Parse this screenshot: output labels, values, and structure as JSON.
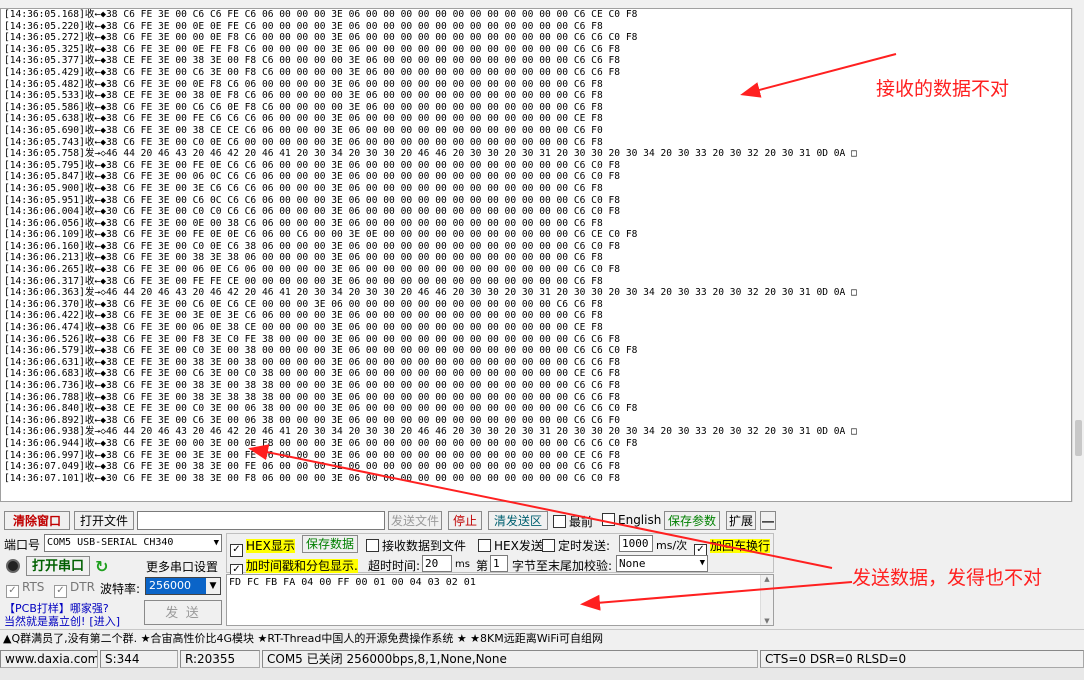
{
  "log": {
    "lines": [
      "[14:36:05.168]收←◆38 C6 FE 3E 00 C6 C6 FE C6 06 00 00 00 3E 06 00 00 00 00 00 00 00 00 00 00 00 00 C6 CE C0 F8",
      "[14:36:05.220]收←◆38 C6 FE 3E 00 0E 0E FE C6 00 00 00 00 3E 06 00 00 00 00 00 00 00 00 00 00 00 00 C6 F8",
      "[14:36:05.272]收←◆38 C6 FE 3E 00 00 0E F8 C6 00 00 00 00 3E 06 00 00 00 00 00 00 00 00 00 00 00 00 C6 C6 C0 F8",
      "[14:36:05.325]收←◆38 C6 FE 3E 00 0E FE F8 C6 00 00 00 00 3E 06 00 00 00 00 00 00 00 00 00 00 00 00 C6 C6 F8",
      "[14:36:05.377]收←◆38 CE FE 3E 00 38 3E 00 F8 C6 00 00 00 00 3E 06 00 00 00 00 00 00 00 00 00 00 00 C6 C6 F8",
      "[14:36:05.429]收←◆38 C6 FE 3E 00 C6 3E 00 F8 C6 00 00 00 00 3E 06 00 00 00 00 00 00 00 00 00 00 00 C6 C6 F8",
      "[14:36:05.482]收←◆38 C6 FE 3E 00 0E F8 C6 06 00 00 00 00 3E 06 00 00 00 00 00 00 00 00 00 00 00 00 C6 F8",
      "[14:36:05.533]收←◆38 CE FE 3E 00 38 0E F8 C6 06 00 00 00 00 3E 06 00 00 00 00 00 00 00 00 00 00 00 C6 F8",
      "[14:36:05.586]收←◆38 C6 FE 3E 00 C6 C6 0E F8 C6 00 00 00 00 3E 06 00 00 00 00 00 00 00 00 00 00 00 C6 F8",
      "[14:36:05.638]收←◆38 C6 FE 3E 00 FE C6 C6 C6 06 00 00 00 3E 06 00 00 00 00 00 00 00 00 00 00 00 00 CE F8",
      "[14:36:05.690]收←◆38 C6 FE 3E 00 38 CE CE C6 06 00 00 00 3E 06 00 00 00 00 00 00 00 00 00 00 00 00 C6 F0",
      "[14:36:05.743]收←◆38 C6 FE 3E 00 C0 0E C6 00 00 00 00 00 3E 06 00 00 00 00 00 00 00 00 00 00 00 00 C6 F8",
      "[14:36:05.758]发→◇46 44 20 46 43 20 46 42 20 46 41 20 30 34 20 30 30 20 46 46 20 30 30 20 30 31 20 30 30 20 30 34 20 30 33 20 30 32 20 30 31 0D 0A □",
      "[14:36:05.795]收←◆38 C6 FE 3E 00 FE 0E C6 C6 06 00 00 00 3E 06 00 00 00 00 00 00 00 00 00 00 00 00 C6 C0 F8",
      "[14:36:05.847]收←◆38 C6 FE 3E 00 06 0C C6 C6 06 00 00 00 3E 06 00 00 00 00 00 00 00 00 00 00 00 00 C6 C0 F8",
      "[14:36:05.900]收←◆38 C6 FE 3E 00 3E C6 C6 C6 06 00 00 00 3E 06 00 00 00 00 00 00 00 00 00 00 00 00 C6 F8",
      "[14:36:05.951]收←◆38 C6 FE 3E 00 C6 0C C6 C6 06 00 00 00 3E 06 00 00 00 00 00 00 00 00 00 00 00 00 C6 C0 F8",
      "[14:36:06.004]收←◆30 C6 FE 3E 00 C0 C0 C6 C6 06 00 00 00 3E 06 00 00 00 00 00 00 00 00 00 00 00 00 C6 C0 F8",
      "[14:36:06.056]收←◆38 C6 FE 3E 00 0E 00 38 C6 06 00 00 00 3E 06 00 00 00 00 00 00 00 00 00 00 00 00 C6 F8",
      "[14:36:06.109]收←◆38 C6 FE 3E 00 FE 0E 0E C6 06 00 C6 00 00 3E 0E 00 00 00 00 00 00 00 00 00 00 00 C6 CE C0 F8",
      "[14:36:06.160]收←◆38 C6 FE 3E 00 C0 0E C6 38 06 00 00 00 3E 06 00 00 00 00 00 00 00 00 00 00 00 00 C6 C0 F8",
      "[14:36:06.213]收←◆38 C6 FE 3E 00 38 3E 38 06 00 00 00 00 3E 06 00 00 00 00 00 00 00 00 00 00 00 00 C6 F8",
      "[14:36:06.265]收←◆38 C6 FE 3E 00 06 0E C6 06 00 00 00 00 3E 06 00 00 00 00 00 00 00 00 00 00 00 00 C6 C0 F8",
      "[14:36:06.317]收←◆38 C6 FE 3E 00 FE FE CE 00 00 00 00 00 3E 06 00 00 00 00 00 00 00 00 00 00 00 00 C6 F8",
      "[14:36:06.363]发→◇46 44 20 46 43 20 46 42 20 46 41 20 30 34 20 30 30 20 46 46 20 30 30 20 30 31 20 30 30 20 30 34 20 30 33 20 30 32 20 30 31 0D 0A □",
      "[14:36:06.370]收←◆38 C6 FE 3E 00 C6 0E C6 CE 00 00 00 3E 06 00 00 00 00 00 00 00 00 00 00 00 00 C6 C6 F8",
      "[14:36:06.422]收←◆38 C6 FE 3E 00 3E 0E 3E C6 06 00 00 00 3E 06 00 00 00 00 00 00 00 00 00 00 00 00 C6 F8",
      "[14:36:06.474]收←◆38 C6 FE 3E 00 06 0E 38 CE 00 00 00 00 3E 06 00 00 00 00 00 00 00 00 00 00 00 00 CE F8",
      "[14:36:06.526]收←◆38 C6 FE 3E 00 F8 3E C0 FE 38 00 00 00 3E 06 00 00 00 00 00 00 00 00 00 00 00 00 C6 C6 F8",
      "[14:36:06.579]收←◆38 C6 FE 3E 00 C0 3E 00 38 00 00 00 00 3E 06 00 00 00 00 00 00 00 00 00 00 00 00 C6 C6 C0 F8",
      "[14:36:06.631]收←◆38 CE FE 3E 00 38 3E 00 38 00 00 00 00 3E 06 00 00 00 00 00 00 00 00 00 00 00 00 C6 C6 F8",
      "[14:36:06.683]收←◆38 C6 FE 3E 00 C6 3E 00 C0 38 00 00 00 3E 06 00 00 00 00 00 00 00 00 00 00 00 00 CE C6 F8",
      "[14:36:06.736]收←◆38 C6 FE 3E 00 38 3E 00 38 38 00 00 00 3E 06 00 00 00 00 00 00 00 00 00 00 00 00 C6 C6 F8",
      "[14:36:06.788]收←◆38 C6 FE 3E 00 38 3E 38 38 38 00 00 00 3E 06 00 00 00 00 00 00 00 00 00 00 00 00 C6 C6 F8",
      "[14:36:06.840]收←◆38 CE FE 3E 00 C0 3E 00 06 38 00 00 00 3E 06 00 00 00 00 00 00 00 00 00 00 00 00 C6 C6 C0 F8",
      "[14:36:06.892]收←◆38 C6 FE 3E 00 C6 3E 00 06 38 00 00 00 3E 06 00 00 00 00 00 00 00 00 00 00 00 00 C6 C6 F0",
      "[14:36:06.938]发→◇46 44 20 46 43 20 46 42 20 46 41 20 30 34 20 30 30 20 46 46 20 30 30 20 30 31 20 30 30 20 30 34 20 30 33 20 30 32 20 30 31 0D 0A □",
      "[14:36:06.944]收←◆38 C6 FE 3E 00 00 3E 00 0E F8 00 00 00 3E 06 00 00 00 00 00 00 00 00 00 00 00 00 C6 C6 C0 F8",
      "[14:36:06.997]收←◆38 C6 FE 3E 00 3E 3E 00 FE 06 00 00 00 3E 06 00 00 00 00 00 00 00 00 00 00 00 00 CE C6 F8",
      "[14:36:07.049]收←◆38 C6 FE 3E 00 38 3E 00 FE 06 00 00 00 3E 06 00 00 00 00 00 00 00 00 00 00 00 00 C6 C6 F8",
      "[14:36:07.101]收←◆30 C6 FE 3E 00 38 3E 00 F8 06 00 00 00 3E 06 00 00 00 00 00 00 00 00 00 00 00 00 C6 C0 F8"
    ]
  },
  "toolbar": {
    "clear_window": "清除窗口",
    "open_file": "打开文件",
    "file_path": "",
    "send_file": "发送文件",
    "stop": "停止",
    "clear_send": "清发送区",
    "topmost": "最前",
    "english": "English",
    "save_params": "保存参数",
    "expand": "扩展",
    "collapse": "—"
  },
  "port": {
    "port_label": "端口号",
    "port_value": "COM5 USB-SERIAL CH340",
    "more_settings": "更多串口设置",
    "open_port": "打开串口",
    "rts": "RTS",
    "dtr": "DTR",
    "baud_label": "波特率:",
    "baud_value": "256000",
    "ad_line1": "【PCB打样】哪家强?",
    "ad_line2": "当然就是嘉立创!",
    "ad_enter": "[进入]",
    "send_button": "发 送"
  },
  "options": {
    "hex_display": "HEX显示",
    "save_data": "保存数据",
    "recv_to_file": "接收数据到文件",
    "hex_send": "HEX发送",
    "timed_send": "定时发送:",
    "interval": "1000",
    "interval_unit": "ms/次",
    "add_crlf": "加回车换行",
    "add_timestamp": "加时间戳和分包显示.",
    "timeout_label": "超时时间:",
    "timeout_value": "20",
    "timeout_unit": "ms",
    "nth_label": "第",
    "nth_value": "1",
    "checksum_label": "字节至末尾加校验:",
    "checksum_value": "None"
  },
  "send_area": {
    "text": "FD FC FB FA 04 00 FF 00 01 00 04 03 02 01"
  },
  "ticker": {
    "text": "▲Q群满员了,没有第二个群. ★合宙高性价比4G模块 ★RT-Thread中国人的开源免费操作系统 ★ ★8KM远距离WiFi可自组网"
  },
  "status": {
    "website": "www.daxia.com",
    "sent": "S:344",
    "received": "R:20355",
    "port_state": "COM5 已关闭  256000bps,8,1,None,None",
    "lines": "CTS=0 DSR=0 RLSD=0"
  },
  "annotations": {
    "recv_wrong": "接收的数据不对",
    "send_wrong": "发送数据，发得也不对",
    "color": "#ff2020"
  }
}
